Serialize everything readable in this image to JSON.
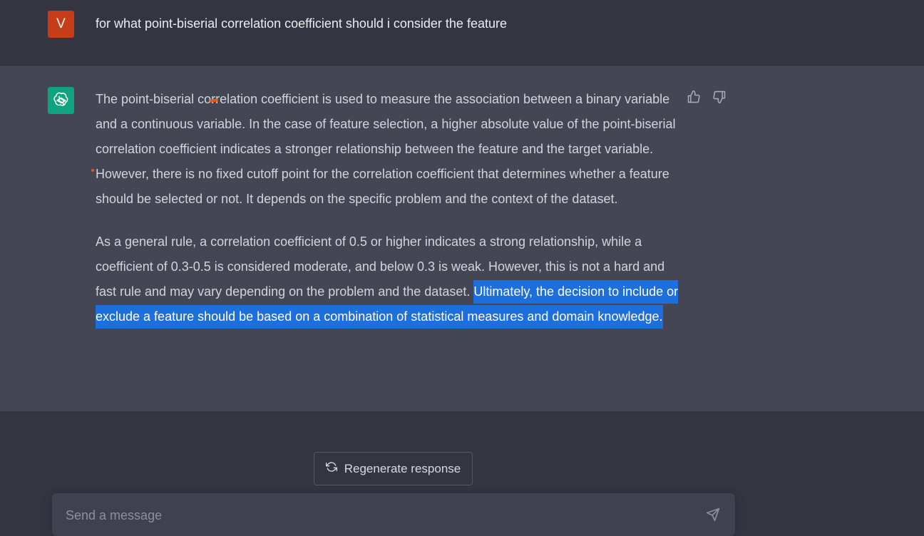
{
  "user_message": {
    "avatar_letter": "V",
    "text": "for what point-biserial correlation coefficient should i consider the feature"
  },
  "assistant_message": {
    "avatar_icon": "openai-logo-icon",
    "paragraph1": "The point-biserial correlation coefficient is used to measure the association between a binary variable and a continuous variable. In the case of feature selection, a higher absolute value of the point-biserial correlation coefficient indicates a stronger relationship between the feature and the target variable. However, there is no fixed cutoff point for the correlation coefficient that determines whether a feature should be selected or not. It depends on the specific problem and the context of the dataset.",
    "paragraph2_plain": "As a general rule, a correlation coefficient of 0.5 or higher indicates a strong relationship, while a coefficient of 0.3-0.5 is considered moderate, and below 0.3 is weak. However, this is not a hard and fast rule and may vary depending on the problem and the dataset. ",
    "paragraph2_selected": "Ultimately, the decision to include or exclude a feature should be based on a combination of statistical measures and domain knowledge.",
    "feedback": {
      "up_icon": "thumbs-up-icon",
      "down_icon": "thumbs-down-icon"
    }
  },
  "controls": {
    "regenerate_label": "Regenerate response",
    "regenerate_icon": "refresh-icon",
    "input_placeholder": "Send a message",
    "send_icon": "send-icon"
  },
  "colors": {
    "background": "#343541",
    "assistant_background": "#444654",
    "user_avatar": "#c63d17",
    "assistant_avatar": "#10a37f",
    "selection": "#1c6fdc"
  }
}
